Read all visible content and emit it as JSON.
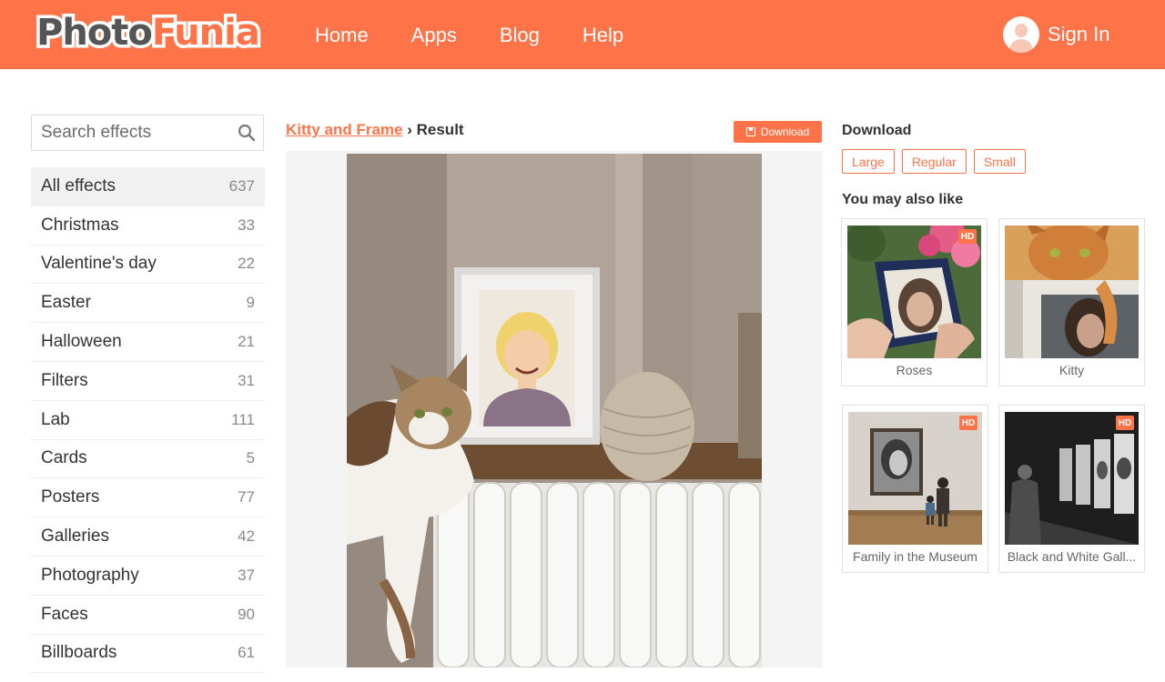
{
  "header": {
    "logo_part1": "Photo",
    "logo_part2": "Funia",
    "nav": [
      "Home",
      "Apps",
      "Blog",
      "Help"
    ],
    "signin_label": "Sign In"
  },
  "sidebar": {
    "search_placeholder": "Search effects",
    "categories": [
      {
        "label": "All effects",
        "count": "637"
      },
      {
        "label": "Christmas",
        "count": "33"
      },
      {
        "label": "Valentine's day",
        "count": "22"
      },
      {
        "label": "Easter",
        "count": "9"
      },
      {
        "label": "Halloween",
        "count": "21"
      },
      {
        "label": "Filters",
        "count": "31"
      },
      {
        "label": "Lab",
        "count": "111"
      },
      {
        "label": "Cards",
        "count": "5"
      },
      {
        "label": "Posters",
        "count": "77"
      },
      {
        "label": "Galleries",
        "count": "42"
      },
      {
        "label": "Photography",
        "count": "37"
      },
      {
        "label": "Faces",
        "count": "90"
      },
      {
        "label": "Billboards",
        "count": "61"
      }
    ]
  },
  "main": {
    "breadcrumb_link": "Kitty and Frame",
    "breadcrumb_sep": "›",
    "breadcrumb_current": "Result",
    "download_button": "Download"
  },
  "right": {
    "download_heading": "Download",
    "sizes": [
      "Large",
      "Regular",
      "Small"
    ],
    "also_like_heading": "You may also like",
    "hd_badge": "HD",
    "suggestions": [
      {
        "label": "Roses"
      },
      {
        "label": "Kitty"
      },
      {
        "label": "Family in the Museum"
      },
      {
        "label": "Black and White Gall..."
      }
    ]
  },
  "colors": {
    "brand": "#ff7348",
    "text": "#333333",
    "muted": "#8a8a8a"
  }
}
